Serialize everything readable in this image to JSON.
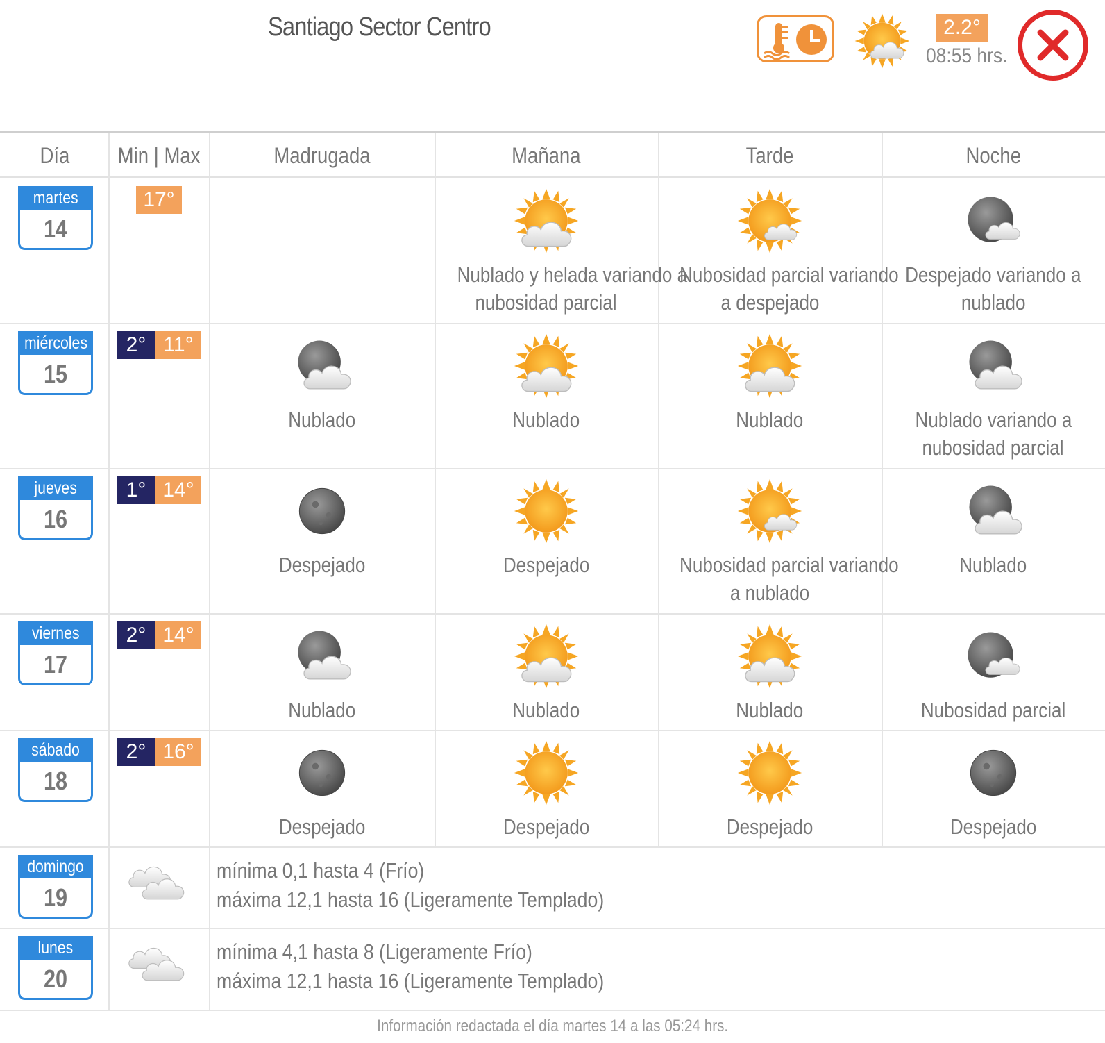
{
  "header": {
    "title": "Santiago Sector Centro",
    "current_temp": "2.2°",
    "current_time": "08:55 hrs.",
    "thermo_button_icon": "thermometer-clock-icon",
    "current_condition_icon": "sun-cloud-icon",
    "close_icon": "close-icon",
    "accent": "#f0923a",
    "close_color": "#e02a2a"
  },
  "columns": [
    "Día",
    "Min | Max",
    "Madrugada",
    "Mañana",
    "Tarde",
    "Noche"
  ],
  "days": [
    {
      "name": "martes",
      "num": "14",
      "min": "",
      "max": "17°",
      "periods": [
        {
          "icon": "",
          "text": []
        },
        {
          "icon": "sun-cloud",
          "text": [
            "Nublado y helada variando a",
            "nubosidad parcial"
          ]
        },
        {
          "icon": "sun-cloud-small",
          "text": [
            "Nubosidad parcial variando",
            "a despejado"
          ]
        },
        {
          "icon": "moon-cloud-small",
          "text": [
            "Despejado variando a",
            "nublado"
          ]
        }
      ]
    },
    {
      "name": "miércoles",
      "num": "15",
      "min": "2°",
      "max": "11°",
      "periods": [
        {
          "icon": "moon-cloud",
          "text": [
            "Nublado"
          ]
        },
        {
          "icon": "sun-cloud",
          "text": [
            "Nublado"
          ]
        },
        {
          "icon": "sun-cloud",
          "text": [
            "Nublado"
          ]
        },
        {
          "icon": "moon-cloud",
          "text": [
            "Nublado variando a",
            "nubosidad parcial"
          ]
        }
      ]
    },
    {
      "name": "jueves",
      "num": "16",
      "min": "1°",
      "max": "14°",
      "periods": [
        {
          "icon": "moon",
          "text": [
            "Despejado"
          ]
        },
        {
          "icon": "sun",
          "text": [
            "Despejado"
          ]
        },
        {
          "icon": "sun-cloud-small",
          "text": [
            "Nubosidad parcial variando",
            "a nublado"
          ]
        },
        {
          "icon": "moon-cloud",
          "text": [
            "Nublado"
          ]
        }
      ]
    },
    {
      "name": "viernes",
      "num": "17",
      "min": "2°",
      "max": "14°",
      "periods": [
        {
          "icon": "moon-cloud",
          "text": [
            "Nublado"
          ]
        },
        {
          "icon": "sun-cloud",
          "text": [
            "Nublado"
          ]
        },
        {
          "icon": "sun-cloud",
          "text": [
            "Nublado"
          ]
        },
        {
          "icon": "moon-cloud-small",
          "text": [
            "Nubosidad parcial"
          ]
        }
      ]
    },
    {
      "name": "sábado",
      "num": "18",
      "min": "2°",
      "max": "16°",
      "periods": [
        {
          "icon": "moon",
          "text": [
            "Despejado"
          ]
        },
        {
          "icon": "sun",
          "text": [
            "Despejado"
          ]
        },
        {
          "icon": "sun",
          "text": [
            "Despejado"
          ]
        },
        {
          "icon": "moon",
          "text": [
            "Despejado"
          ]
        }
      ]
    }
  ],
  "extended": [
    {
      "name": "domingo",
      "num": "19",
      "icon": "clouds-icon",
      "lines": [
        "mínima 0,1 hasta 4 (Frío)",
        "máxima 12,1 hasta 16 (Ligeramente Templado)"
      ]
    },
    {
      "name": "lunes",
      "num": "20",
      "icon": "clouds-icon",
      "lines": [
        "mínima 4,1 hasta 8 (Ligeramente Frío)",
        "máxima 12,1 hasta 16 (Ligeramente Templado)"
      ]
    }
  ],
  "footer": "Información redactada el día martes 14 a las 05:24 hrs.",
  "colors": {
    "day_blue": "#2f89dc",
    "min_navy": "#242563",
    "max_orange": "#f3a25c"
  }
}
